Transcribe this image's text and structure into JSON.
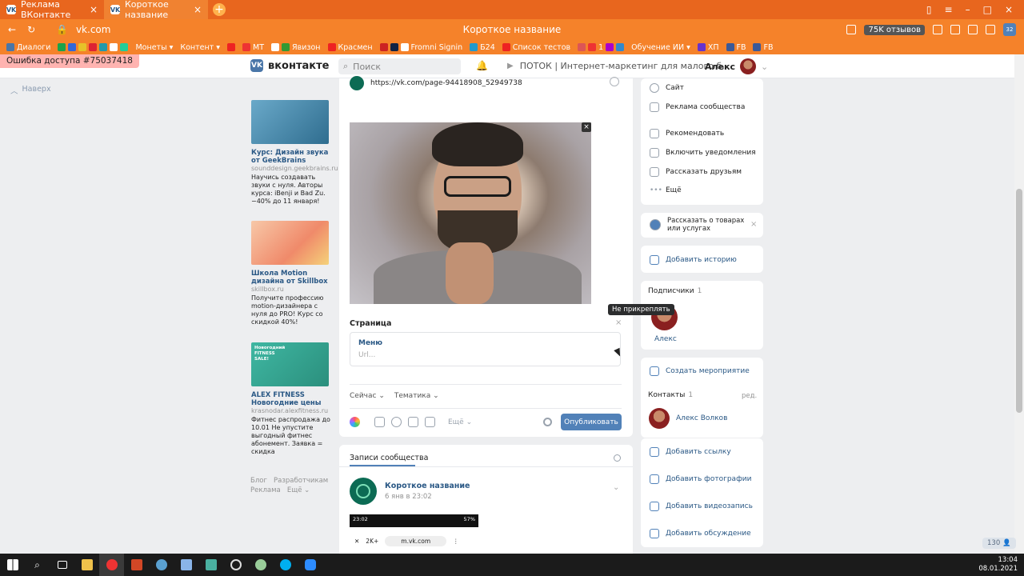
{
  "browser": {
    "tabs": [
      {
        "label": "Реклама ВКонтакте",
        "active": false
      },
      {
        "label": "Короткое название",
        "active": true
      }
    ],
    "url": "vk.com",
    "page_title": "Короткое название",
    "reviews": "75K отзывов",
    "profile_badge": "32",
    "bookmarks": [
      "Диалоги",
      "Монеты",
      "Контент",
      "МТ",
      "Явизон",
      "Красмен",
      "Fromni Signin",
      "Б24",
      "Список тестов",
      "1",
      "Обучение ИИ",
      "ХП",
      "FB",
      "FB"
    ]
  },
  "error_banner": "Ошибка доступа #75037418",
  "header": {
    "logo": "вконтакте",
    "search_placeholder": "Поиск",
    "player": "ПОТОК | Интернет-маркетинг для малого б...",
    "user": "Алекс"
  },
  "nav_up": "Наверх",
  "ads": [
    {
      "title": "Курс: Дизайн звука от GeekBrains",
      "site": "sounddesign.geekbrains.ru",
      "desc": "Научись создавать звуки с нуля. Авторы курса: iBenji и Bad Zu. −40% до 11 января!"
    },
    {
      "title": "Школа Motion дизайна от Skillbox",
      "site": "skillbox.ru",
      "desc": "Получите профессию motion-дизайнера с нуля до PRO! Курс со скидкой 40%!"
    },
    {
      "title": "ALEX FITNESS Новогодние цены",
      "site": "krasnodar.alexfitness.ru",
      "desc": "Фитнес распродажа до 10.01 Не упустите выгодный фитнес абонемент. Заявка = скидка",
      "img_text": "Новогодний FITNESS SALE!"
    }
  ],
  "footer_links": [
    "Блог",
    "Разработчикам",
    "Реклама",
    "Ещё"
  ],
  "composer": {
    "link": "https://vk.com/page-94418908_52949738",
    "section_label": "Страница",
    "tooltip": "Не прикреплять",
    "menu_label": "Меню",
    "url_placeholder": "Url...",
    "when": "Сейчас",
    "topic": "Тематика",
    "more": "Ещё",
    "publish": "Опубликовать"
  },
  "posts": {
    "tab": "Записи сообщества",
    "post_name": "Короткое название",
    "post_date": "6 янв в 23:02",
    "shot_time": "23:02",
    "shot_battery": "57%",
    "shot_badge": "2K+",
    "shot_url": "m.vk.com"
  },
  "right": {
    "info_items": [
      "Сайт",
      "Реклама сообщества",
      "Рекомендовать",
      "Включить уведомления",
      "Рассказать друзьям",
      "Ещё"
    ],
    "products_prompt": "Рассказать о товарах или услугах",
    "add_story": "Добавить историю",
    "subscribers_label": "Подписчики",
    "subscribers_count": "1",
    "subscriber_name": "Алекс",
    "create_event": "Создать мероприятие",
    "contacts_label": "Контакты",
    "contacts_count": "1",
    "contacts_edit": "ред.",
    "contact_name": "Алекс Волков",
    "add_link": "Добавить ссылку",
    "add_photos": "Добавить фотографии",
    "add_video": "Добавить видеозапись",
    "add_discussion": "Добавить обсуждение",
    "online_counter": "130"
  },
  "taskbar": {
    "time": "13:04",
    "date": "08.01.2021"
  }
}
